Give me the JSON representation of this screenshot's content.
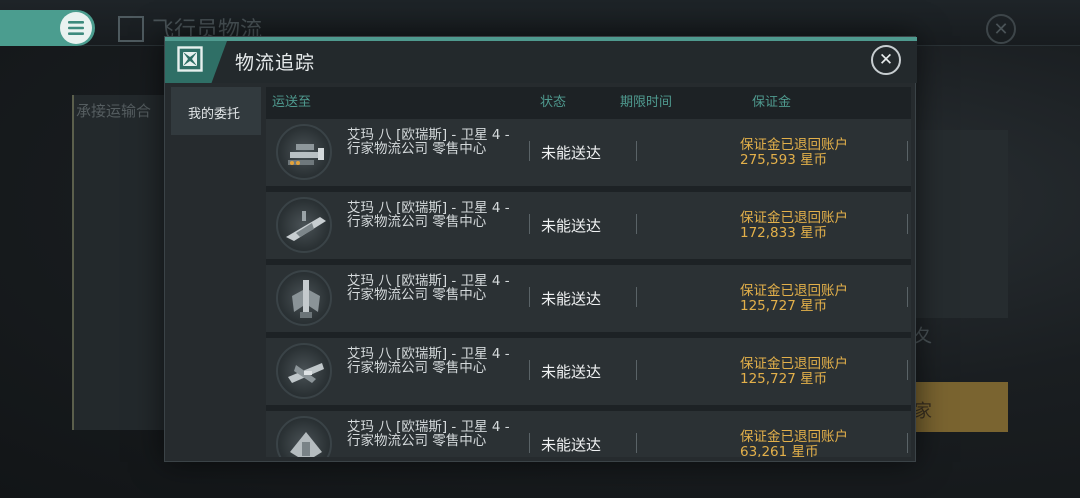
{
  "background": {
    "title": "飞行员物流",
    "tab": "承接运输合",
    "right_text": "夂",
    "yellow_text": "家"
  },
  "modal": {
    "title": "物流追踪",
    "close_icon": "close-icon",
    "sidebar": {
      "items": [
        {
          "label": "我的委托"
        }
      ]
    },
    "columns": {
      "destination": "运送至",
      "status": "状态",
      "deadline": "期限时间",
      "deposit": "保证金"
    },
    "rows": [
      {
        "destination": "艾玛 八 [欧瑞斯] - 卫星 4 - 行家物流公司 零售中心",
        "status": "未能送达",
        "deadline": "",
        "deposit_status": "保证金已退回账户",
        "deposit_amount": "275,593 星币",
        "ship_icon": "battleship-icon"
      },
      {
        "destination": "艾玛 八 [欧瑞斯] - 卫星 4 - 行家物流公司 零售中心",
        "status": "未能送达",
        "deadline": "",
        "deposit_status": "保证金已退回账户",
        "deposit_amount": "172,833 星币",
        "ship_icon": "cruiser-icon"
      },
      {
        "destination": "艾玛 八 [欧瑞斯] - 卫星 4 - 行家物流公司 零售中心",
        "status": "未能送达",
        "deadline": "",
        "deposit_status": "保证金已退回账户",
        "deposit_amount": "125,727 星币",
        "ship_icon": "frigate-icon"
      },
      {
        "destination": "艾玛 八 [欧瑞斯] - 卫星 4 - 行家物流公司 零售中心",
        "status": "未能送达",
        "deadline": "",
        "deposit_status": "保证金已退回账户",
        "deposit_amount": "125,727 星币",
        "ship_icon": "destroyer-icon"
      },
      {
        "destination": "艾玛 八 [欧瑞斯] - 卫星 4 - 行家物流公司 零售中心",
        "status": "未能送达",
        "deadline": "",
        "deposit_status": "保证金已退回账户",
        "deposit_amount": "63,261 星币",
        "ship_icon": "hauler-icon"
      }
    ]
  },
  "colors": {
    "accent": "#4f9a8f",
    "deposit_text": "#e3b04a",
    "panel": "#262b2e"
  }
}
